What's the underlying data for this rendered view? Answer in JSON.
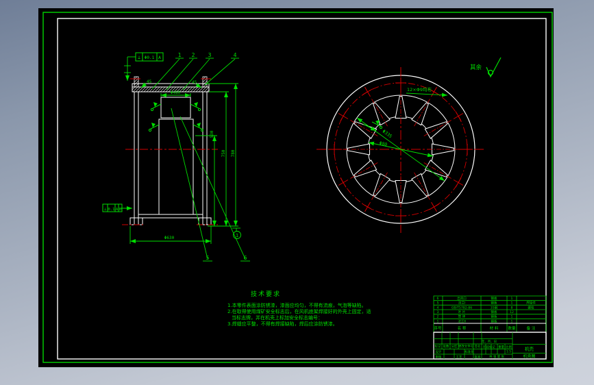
{
  "colors": {
    "canvas": "#000000",
    "frame_green": "#00c800",
    "drawing_white": "#ffffff",
    "centerline_red": "#d40000",
    "annotation_green": "#00df00"
  },
  "surface": {
    "rest_label": "其余"
  },
  "left_view": {
    "callouts": {
      "c1": "1",
      "c2": "2",
      "c3": "3",
      "c4": "4",
      "c5": "5",
      "c6": "6"
    },
    "weld_no": "1",
    "dims": {
      "chamfer_l": "45",
      "chamfer_r": "45",
      "hub_w": "Φ480",
      "h1": "530",
      "h2": "750",
      "h3": "780",
      "bottom": "Φ630"
    },
    "fcf_top": {
      "sym": "⊥",
      "tol": "Φ0.1",
      "datum": "A"
    },
    "fcf_side": {
      "sym": "⊥",
      "tol": "0.1",
      "d1": "A",
      "d2": "B"
    }
  },
  "right_view": {
    "dims": {
      "holes": "12×Φ9均布",
      "d1": "Φ335",
      "d2": "Φ80"
    }
  },
  "notes": {
    "title": "技术要求",
    "l1": "1.本零件表面涂防锈漆，漆面应均匀，不得有流痕，气泡等缺陷。",
    "l2": "2.在取得使用煤矿安全标志后，在风机底架焊接好的外壳上固定，适",
    "l3": "当标志牌，并在机壳上标加安全标志编号：",
    "l4": "3.焊缝应平整，不得有焊接缺陷，焊后应涂防锈漆。"
  },
  "bom": {
    "headers": [
      "序号",
      "名  称",
      "材  料",
      "数量",
      "备  注"
    ],
    "rows": [
      [
        "6",
        "出风口",
        "钢板",
        "1",
        ""
      ],
      [
        "5",
        "法兰Ⅰ",
        "钢板",
        "1",
        "焊接件"
      ],
      [
        "4",
        "GB/T5782-86",
        "35钢",
        "8",
        "螺栓"
      ],
      [
        "3",
        "叶 片",
        "钢板",
        "12",
        ""
      ],
      [
        "2",
        "筒 体",
        "钢板",
        "1",
        ""
      ],
      [
        "1",
        "法兰Ⅱ",
        "钢板",
        "1",
        ""
      ]
    ]
  },
  "titleblock": {
    "marks": [
      "标记",
      "处数",
      "分区",
      "更改文件号",
      "签名",
      "年、月、日"
    ],
    "design": "设计",
    "audit": "审核",
    "craft": "工艺",
    "std": "标准化",
    "approve": "批准",
    "stage": "阶段标记",
    "weight": "重量",
    "scale": "比例",
    "scale_val": "1:5",
    "sheets": "共 张 第 张",
    "part_name": "机壳",
    "code": "机壳图"
  }
}
